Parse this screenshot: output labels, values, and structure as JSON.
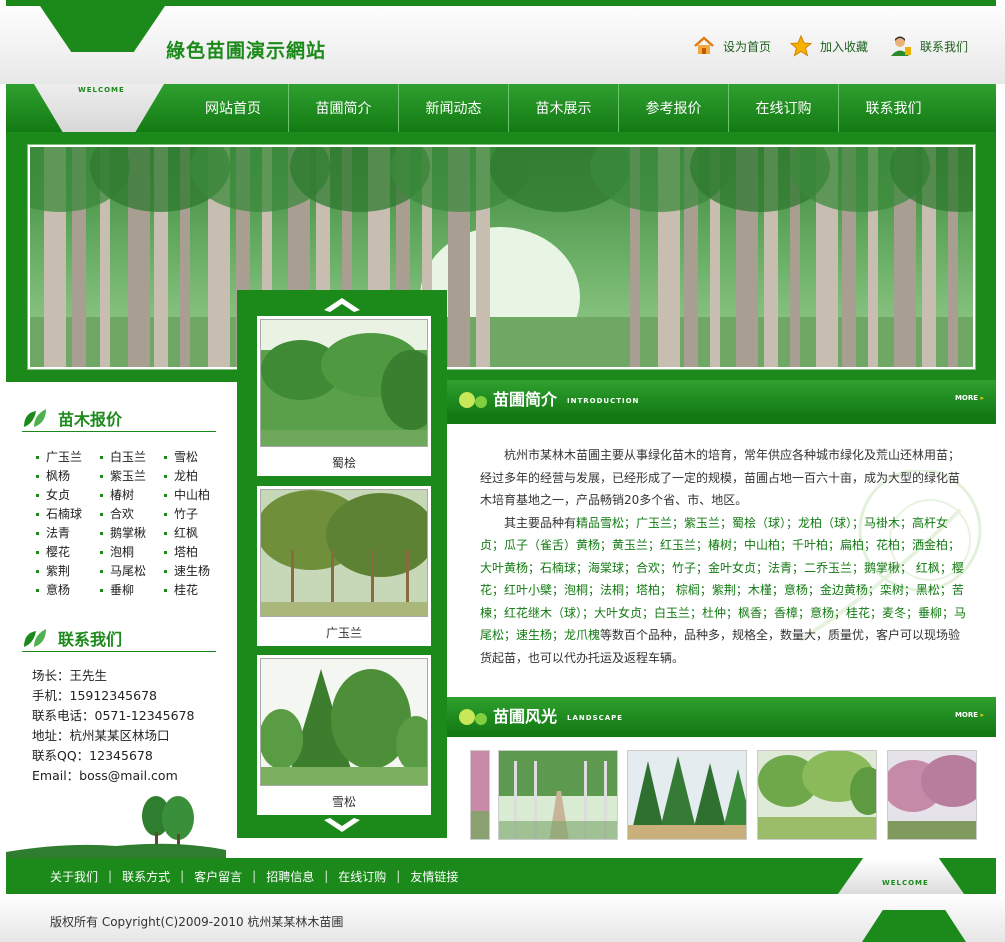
{
  "site": {
    "title": "綠色苗圃演示網站",
    "welcome": "WELCOME"
  },
  "toplinks": [
    {
      "label": "设为首页",
      "icon": "home-icon"
    },
    {
      "label": "加入收藏",
      "icon": "star-icon"
    },
    {
      "label": "联系我们",
      "icon": "user-icon"
    }
  ],
  "nav": [
    "网站首页",
    "苗圃简介",
    "新闻动态",
    "苗木展示",
    "参考报价",
    "在线订购",
    "联系我们"
  ],
  "colors": {
    "brand_green": "#1b8a1b",
    "dark_green": "#137a13"
  },
  "products": [
    {
      "caption": "蜀桧"
    },
    {
      "caption": "广玉兰"
    },
    {
      "caption": "雪松"
    }
  ],
  "price": {
    "title": "苗木报价",
    "items": [
      "广玉兰",
      "白玉兰",
      "雪松",
      "枫杨",
      "紫玉兰",
      "龙柏",
      "女贞",
      "椿树",
      "中山柏",
      "石楠球",
      "合欢",
      "竹子",
      "法青",
      "鹅掌楸",
      "红枫",
      "樱花",
      "泡桐",
      "塔柏",
      "紫荆",
      "马尾松",
      "速生杨",
      "意杨",
      "垂柳",
      "桂花"
    ]
  },
  "contact": {
    "title": "联系我们",
    "rows": [
      "场长：王先生",
      "手机：15912345678",
      "联系电话：0571-12345678",
      "地址：杭州某某区林场口",
      "联系QQ：12345678",
      "Email：boss@mail.com"
    ]
  },
  "intro": {
    "title": "苗圃简介",
    "english": "INTRODUCTION",
    "more": "MORE",
    "p1": "杭州市某林木苗圃主要从事绿化苗木的培育，常年供应各种城市绿化及荒山还林用苗；经过多年的经营与发展，已经形成了一定的规模，苗圃占地一百六十亩，成为大型的绿化苗木培育基地之一，产品畅销20多个省、市、地区。",
    "p2_lead": "其主要品种有",
    "p2_varieties": "精品雪松；广玉兰；紫玉兰；蜀桧（球）；龙柏（球）；马褂木；高杆女贞；瓜子（雀舌）黄杨；黄玉兰；红玉兰；椿树；中山柏；千叶柏；扁柏；花柏；洒金柏；大叶黄杨；石楠球；海棠球；合欢；竹子；金叶女贞；法青；二乔玉兰；鹅掌楸； 红枫；樱花；红叶小檗；泡桐；法桐；塔柏； 棕榈；紫荆；木槿；意杨；金边黄杨；栾树；黑松；苦楝；红花继木（球）；大叶女贞；白玉兰；杜仲；枫香；香樟；意杨；桂花；麦冬；垂柳；马尾松；速生杨；龙爪槐",
    "p2_tail": "等数百个品种，品种多，规格全，数量大，质量优，客户可以现场验货起苗，也可以代办托运及返程车辆。"
  },
  "landscape": {
    "title": "苗圃风光",
    "english": "LANDSCAPE",
    "more": "MORE"
  },
  "footer": {
    "links": [
      "关于我们",
      "联系方式",
      "客户留言",
      "招聘信息",
      "在线订购",
      "友情链接"
    ],
    "copyright": "版权所有  Copyright(C)2009-2010 杭州某某林木苗圃"
  }
}
